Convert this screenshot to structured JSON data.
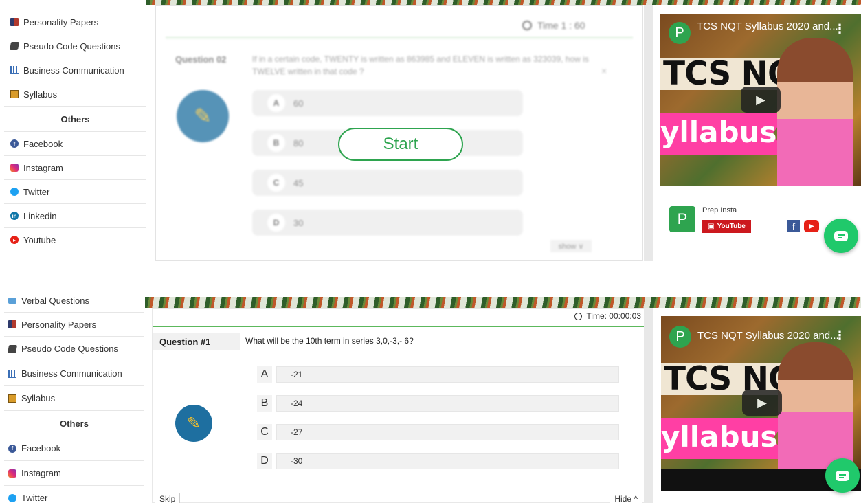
{
  "top": {
    "sidebar": {
      "items": [
        {
          "label": "Personality Papers",
          "icon": "book-icon"
        },
        {
          "label": "Pseudo Code Questions",
          "icon": "stack-icon"
        },
        {
          "label": "Business Communication",
          "icon": "chart-icon"
        },
        {
          "label": "Syllabus",
          "icon": "notebook-icon"
        }
      ],
      "others_heading": "Others",
      "social": [
        {
          "label": "Facebook",
          "icon": "facebook-icon"
        },
        {
          "label": "Instagram",
          "icon": "instagram-icon"
        },
        {
          "label": "Twitter",
          "icon": "twitter-icon"
        },
        {
          "label": "Linkedin",
          "icon": "linkedin-icon"
        },
        {
          "label": "Youtube",
          "icon": "youtube-icon"
        }
      ]
    },
    "quiz": {
      "timer": "Time 1 : 60",
      "question_label": "Question 02",
      "question_text": "If in a certain code, TWENTY is written as 863985 and ELEVEN is written as 323039, how is TWELVE written in that code ?",
      "options": [
        {
          "letter": "A",
          "value": "60"
        },
        {
          "letter": "B",
          "value": "80"
        },
        {
          "letter": "C",
          "value": "45"
        },
        {
          "letter": "D",
          "value": "30"
        }
      ],
      "start_label": "Start",
      "show_label": "show ∨",
      "close_glyph": "×"
    },
    "video": {
      "title": "TCS NQT Syllabus 2020 and...",
      "channel_initial": "P",
      "thumb_text_1": "TCS NQT",
      "thumb_text_2": "yllabus",
      "channel_name": "Prep Insta",
      "youtube_badge": "YouTube"
    }
  },
  "bottom": {
    "sidebar": {
      "items": [
        {
          "label": "Verbal Questions",
          "icon": "verbal-icon"
        },
        {
          "label": "Personality Papers",
          "icon": "book-icon"
        },
        {
          "label": "Pseudo Code Questions",
          "icon": "stack-icon"
        },
        {
          "label": "Business Communication",
          "icon": "chart-icon"
        },
        {
          "label": "Syllabus",
          "icon": "notebook-icon"
        }
      ],
      "others_heading": "Others",
      "social": [
        {
          "label": "Facebook",
          "icon": "facebook-icon"
        },
        {
          "label": "Instagram",
          "icon": "instagram-icon"
        },
        {
          "label": "Twitter",
          "icon": "twitter-icon"
        }
      ]
    },
    "quiz": {
      "timer": "Time: 00:00:03",
      "question_label": "Question #1",
      "question_text": "What will be the 10th term in series 3,0,-3,- 6?",
      "options": [
        {
          "letter": "A",
          "value": "-21"
        },
        {
          "letter": "B",
          "value": "-24"
        },
        {
          "letter": "C",
          "value": "-27"
        },
        {
          "letter": "D",
          "value": "-30"
        }
      ],
      "skip_label": "Skip",
      "hide_label": "Hide ^"
    },
    "video": {
      "title": "TCS NQT Syllabus 2020 and...",
      "channel_initial": "P",
      "thumb_text_1": "TCS NQT",
      "thumb_text_2": "yllabus"
    }
  },
  "colors": {
    "accent_green": "#2ea44f",
    "chat_green": "#20c96b",
    "youtube_red": "#e62117"
  }
}
